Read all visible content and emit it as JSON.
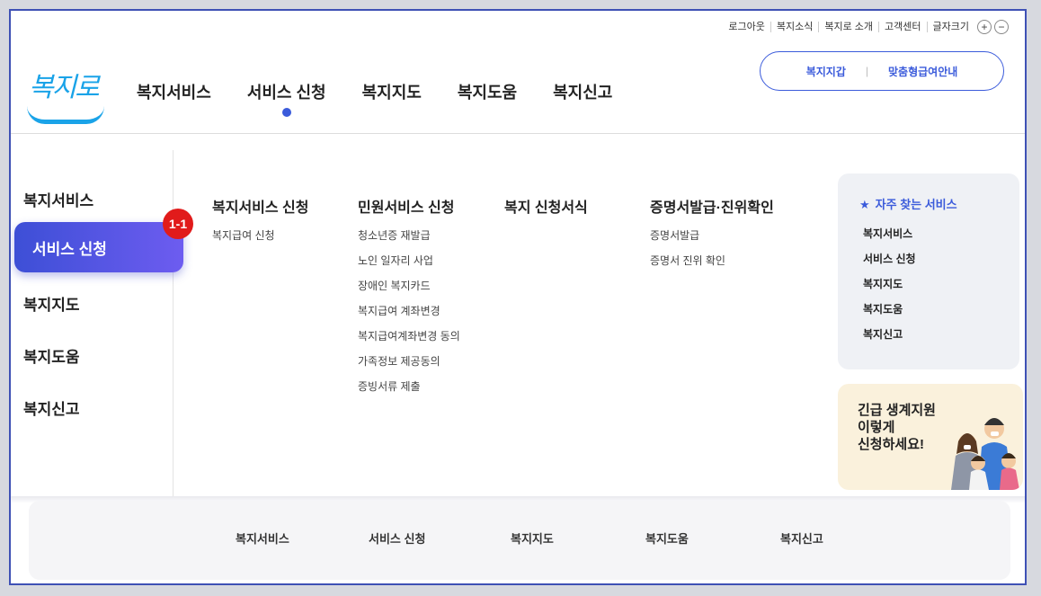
{
  "util": {
    "items": [
      "로그아웃",
      "복지소식",
      "복지로 소개",
      "고객센터",
      "글자크기"
    ],
    "plus": "+",
    "minus": "−"
  },
  "logo": {
    "text": "복지로"
  },
  "gnb": [
    "복지서비스",
    "서비스 신청",
    "복지지도",
    "복지도움",
    "복지신고"
  ],
  "pill": {
    "left": "복지지갑",
    "sep": "|",
    "right": "맞춤형급여안내"
  },
  "side": [
    "복지서비스",
    "서비스 신청",
    "복지지도",
    "복지도움",
    "복지신고"
  ],
  "badge": "1-1",
  "columns": [
    {
      "title": "복지서비스 신청",
      "items": [
        "복지급여 신청"
      ]
    },
    {
      "title": "민원서비스 신청",
      "items": [
        "청소년증 재발급",
        "노인 일자리 사업",
        "장애인 복지카드",
        "복지급여 계좌변경",
        "복지급여계좌변경 동의",
        "가족정보 제공동의",
        "증빙서류 제출"
      ]
    },
    {
      "title": "복지 신청서식",
      "items": []
    },
    {
      "title": "증명서발급·진위확인",
      "items": [
        "증명서발급",
        "증명서 진위 확인"
      ]
    }
  ],
  "favorites": {
    "title": "자주 찾는 서비스",
    "icon": "star-icon",
    "items": [
      "복지서비스",
      "서비스 신청",
      "복지지도",
      "복지도움",
      "복지신고"
    ]
  },
  "promo": {
    "line1": "긴급 생계지원",
    "line2": "이렇게",
    "line3": "신청하세요!"
  },
  "bottom": [
    "복지서비스",
    "서비스 신청",
    "복지지도",
    "복지도움",
    "복지신고"
  ],
  "colors": {
    "accent": "#3b5bdb",
    "logo": "#1aa3e8",
    "badge": "#e11b1b",
    "frame": "#3f51b5"
  }
}
